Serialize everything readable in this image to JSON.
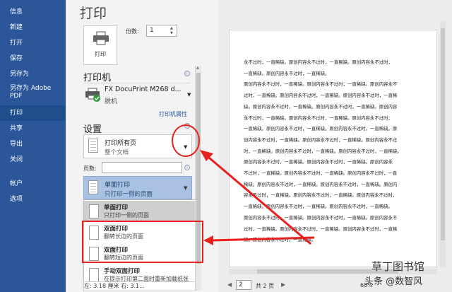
{
  "nav": {
    "items": [
      {
        "label": "信息"
      },
      {
        "label": "新建"
      },
      {
        "label": "打开"
      },
      {
        "label": "保存"
      },
      {
        "label": "另存为"
      },
      {
        "label": "另存为 Adobe PDF"
      },
      {
        "label": "打印",
        "active": true
      },
      {
        "label": "共享"
      },
      {
        "label": "导出"
      },
      {
        "label": "关闭"
      }
    ],
    "bottom_items": [
      {
        "label": "帐户"
      },
      {
        "label": "选项"
      }
    ]
  },
  "print": {
    "title": "打印",
    "print_button_label": "打印",
    "copies_label": "份数:",
    "copies_value": "1"
  },
  "printer": {
    "section_title": "打印机",
    "name": "FX DocuPrint M268 d...",
    "status": "脱机",
    "properties_link": "打印机属性"
  },
  "settings": {
    "section_title": "设置",
    "range_main": "打印所有页",
    "range_sub": "整个文档",
    "pages_label": "页数:",
    "pages_value": "",
    "duplex_main": "单面打印",
    "duplex_sub": "只打印一侧的页面",
    "dropdown_options": [
      {
        "title": "单面打印",
        "sub": "只打印一侧的页面",
        "selected": true
      },
      {
        "title": "双面打印",
        "sub": "翻转长边的页面"
      },
      {
        "title": "双面打印",
        "sub": "翻转短边的页面"
      },
      {
        "title": "手动双面打印",
        "sub": "在提示打印第二面时重新加载纸张"
      }
    ],
    "margins_text": "左: 3.18 厘米   右: 3.1..."
  },
  "preview": {
    "lines": [
      "永不过时，一直稀缺。原创内容永不过时，一直稀缺。原创内容永不过时，",
      "一直稀缺。原创内容永不过时，一直稀缺。",
      "原创内容永不过时，一直稀缺。原创内容永不过时，一直稀缺。原创内容永不",
      "过时，一直稀缺。原创内容永不过时，一直稀缺。原创内容永不过时，一直稀",
      "缺。原创内容永不过时，一直稀缺。原创内容永不过时，一直稀缺。原创内容",
      "永不过时，一直稀缺。原创内容永不过时，一直稀缺。原创内容永不过时，",
      "一直稀缺。原创内容永不过时，一直稀缺。原创内容永不过时，一直稀缺。原",
      "创内容永不过时，一直稀缺。原创内容永不过时，一直稀缺。原创内容永不过",
      "时，一直稀缺。原创内容永不过时，一直稀缺。原创内容永不过时，一直稀缺。",
      "原创内容永不过时，一直稀缺。原创内容永不过时，一直稀缺。原创内容永",
      "不过时，一直稀缺。原创内容永不过时，一直稀缺。原创内容永不过时，一直",
      "稀缺。原创内容永不过时，一直稀缺。原创内容永不过时，一直稀缺。原创内",
      "容永不过时，一直稀缺。原创内容永不过时，一直稀缺。原创内容永不过时，",
      "一直稀缺。原创内容永不过时，一直稀缺。原创内容永不过时，一直稀缺。",
      "原创内容永不过时，一直稀缺。原创内容永不过时，一直稀缺。原创内容永不",
      "过时，一直稀缺。原创内容永不过时，一直稀缺。原创内容永不过时，一直稀",
      "缺。原创内容永不过时，一直稀缺。"
    ],
    "page_current": "2",
    "page_total": "共 2 页",
    "zoom": "60%"
  },
  "watermark": {
    "line1": "草丁图书馆",
    "line2": "头条 @数智风"
  },
  "colors": {
    "nav_bg": "#2b579a",
    "accent_blue": "#2b579a",
    "annotation_red": "#e8201e",
    "duplex_selected_bg": "#a9c1e2"
  }
}
